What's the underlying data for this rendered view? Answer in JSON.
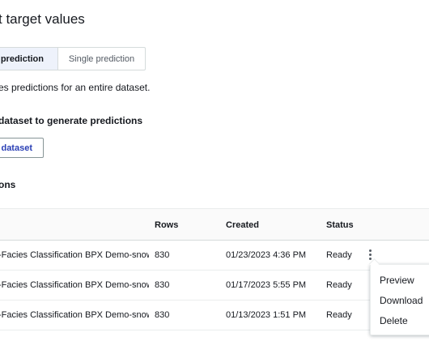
{
  "page": {
    "title": "t target values"
  },
  "mode_tabs": {
    "batch": "n prediction",
    "single": "Single prediction"
  },
  "description": "es predictions for an entire dataset.",
  "select": {
    "label": "dataset to generate predictions",
    "button": "t dataset"
  },
  "section": {
    "title": "ons"
  },
  "table": {
    "headers": {
      "rows": "Rows",
      "created": "Created",
      "status": "Status"
    },
    "rows": [
      {
        "name": "-Facies Classification BPX Demo-snowflake",
        "rows": "830",
        "created": "01/23/2023 4:36 PM",
        "status": "Ready"
      },
      {
        "name": "-Facies Classification BPX Demo-snowflake",
        "rows": "830",
        "created": "01/17/2023 5:55 PM",
        "status": "Ready"
      },
      {
        "name": "-Facies Classification BPX Demo-snowflake",
        "rows": "830",
        "created": "01/13/2023 1:51 PM",
        "status": "Ready"
      }
    ]
  },
  "menu": {
    "preview": "Preview",
    "download": "Download",
    "delete": "Delete"
  },
  "icons": {
    "row_actions": "more-vertical-icon"
  }
}
